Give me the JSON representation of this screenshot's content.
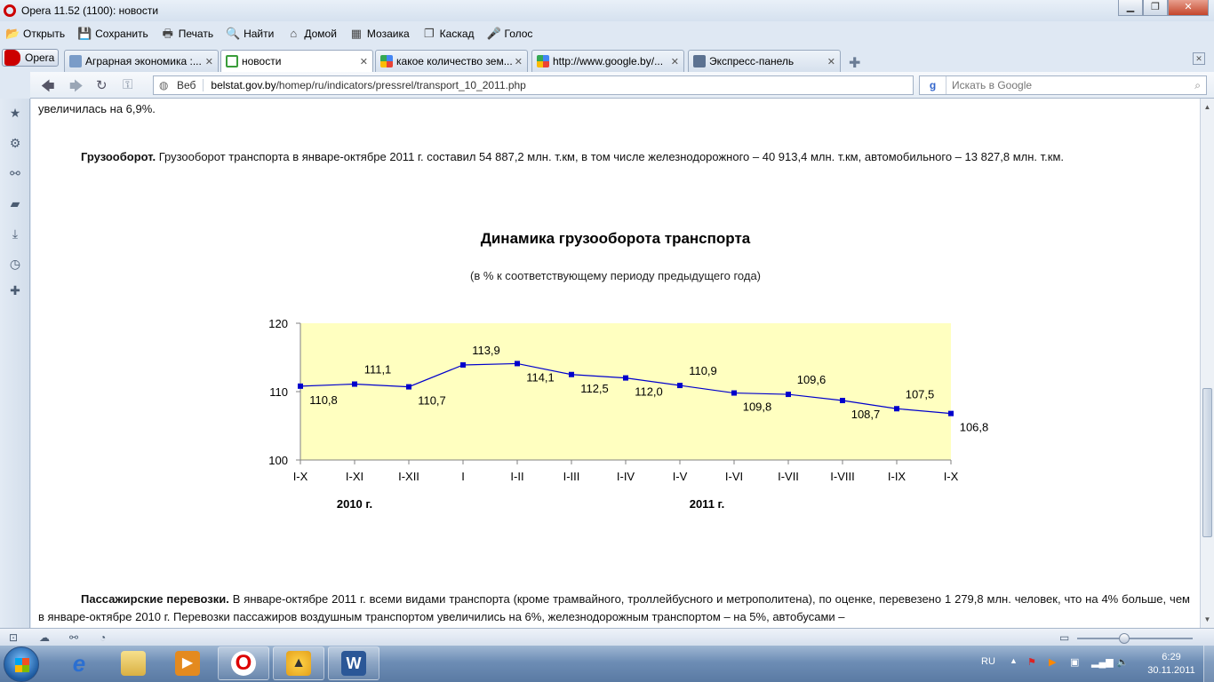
{
  "window": {
    "title": "Opera 11.52 (1100): новости"
  },
  "menu": [
    "Открыть",
    "Сохранить",
    "Печать",
    "Найти",
    "Домой",
    "Мозаика",
    "Каскад",
    "Голос"
  ],
  "opera_button": "Opera",
  "tabs": [
    {
      "label": "Аграрная экономика :...",
      "active": false
    },
    {
      "label": "новости",
      "active": true
    },
    {
      "label": "какое количество зем...",
      "active": false
    },
    {
      "label": "http://www.google.by/...",
      "active": false
    },
    {
      "label": "Экспресс-панель",
      "active": false
    }
  ],
  "address": {
    "mode": "Веб",
    "host": "belstat.gov.by",
    "path": "/homep/ru/indicators/pressrel/transport_10_2011.php"
  },
  "search": {
    "placeholder": "Искать в Google"
  },
  "article": {
    "top_line": "увеличилась на 6,9%.",
    "freight_heading": "Грузооборот.",
    "freight_text": " Грузооборот транспорта в январе-октябре 2011 г. составил 54 887,2 млн. т.км, в том числе железнодорожного – 40 913,4 млн. т.км, автомобильного – 13 827,8 млн. т.км.",
    "passenger_heading": "Пассажирские перевозки.",
    "passenger_text": " В январе-октябре 2011 г. всеми видами транспорта (кроме трамвайного, троллейбусного и метрополитена), по оценке, перевезено 1 279,8 млн. человек, что на 4% больше, чем в январе-октябре 2010 г. Перевозки пассажиров воздушным транспортом увеличились на 6%, железнодорожным транспортом – на 5%, автобусами –"
  },
  "chart_data": {
    "type": "line",
    "title": "Динамика грузооборота транспорта",
    "subtitle": "(в % к соответствующему периоду предыдущего года)",
    "categories": [
      "I-X",
      "I-XI",
      "I-XII",
      "I",
      "I-II",
      "I-III",
      "I-IV",
      "I-V",
      "I-VI",
      "I-VII",
      "I-VIII",
      "I-IX",
      "I-X"
    ],
    "values": [
      110.8,
      111.1,
      110.7,
      113.9,
      114.1,
      112.5,
      112.0,
      110.9,
      109.8,
      109.6,
      108.7,
      107.5,
      106.8
    ],
    "value_labels": [
      "110,8",
      "111,1",
      "110,7",
      "113,9",
      "114,1",
      "112,5",
      "112,0",
      "110,9",
      "109,8",
      "109,6",
      "108,7",
      "107,5",
      "106,8"
    ],
    "label_position": [
      "below",
      "above",
      "below",
      "above",
      "below",
      "below",
      "below",
      "above",
      "below",
      "above",
      "below",
      "above",
      "below"
    ],
    "y_ticks": [
      "100",
      "110",
      "120"
    ],
    "ylim": [
      100,
      120
    ],
    "group_labels": [
      {
        "label": "2010 г.",
        "from": 0,
        "to": 2
      },
      {
        "label": "2011 г.",
        "from": 3,
        "to": 12
      }
    ],
    "plot_color": "#ffffc0",
    "line_color": "#0000cc",
    "grid": false
  },
  "taskbar": {
    "language": "RU",
    "time": "6:29",
    "date": "30.11.2011"
  }
}
